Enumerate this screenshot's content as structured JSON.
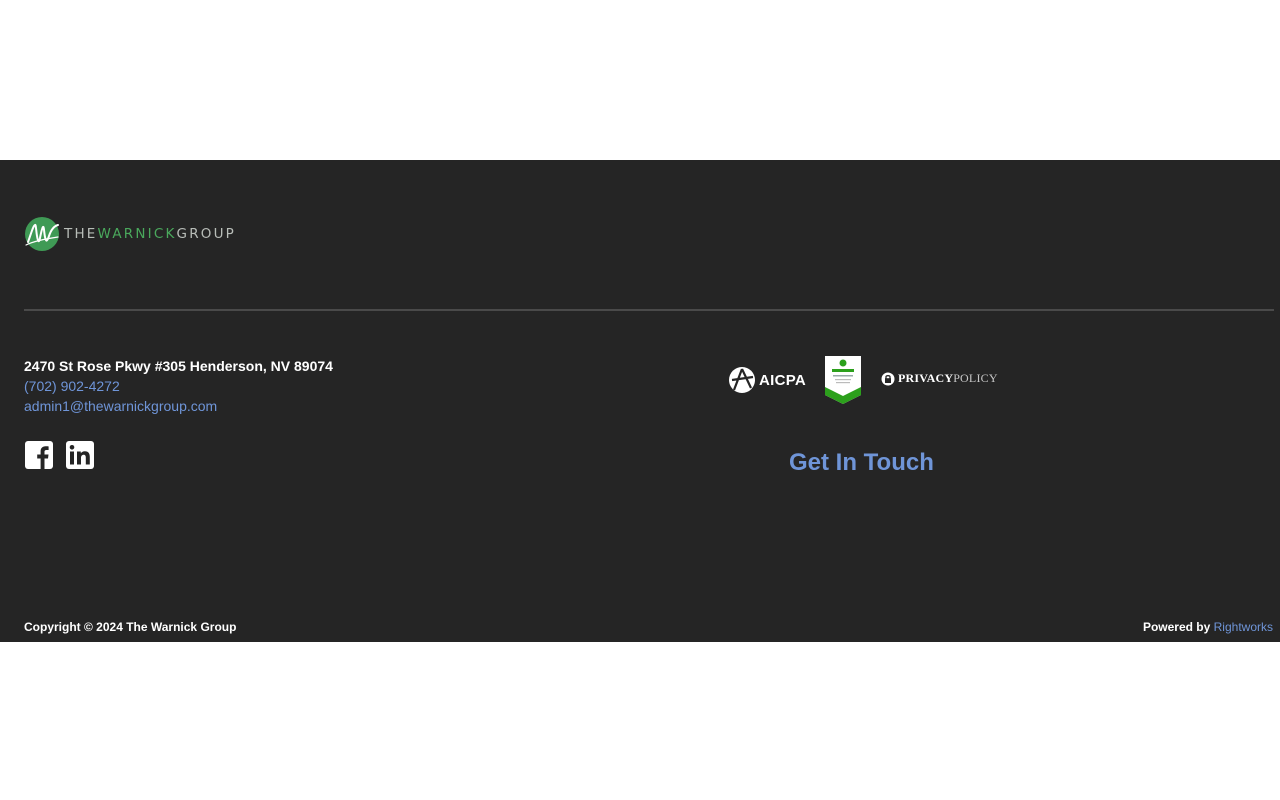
{
  "brand": {
    "logo_text_the": "THE",
    "logo_text_warnick": "WARNICK",
    "logo_text_group": "GROUP",
    "logo_icon": "warnick-w-icon"
  },
  "contact": {
    "address": "2470 St Rose Pkwy #305 Henderson, NV 89074",
    "phone": "(702) 902-4272",
    "email": "admin1@thewarnickgroup.com"
  },
  "social": {
    "facebook_icon": "facebook-icon",
    "linkedin_icon": "linkedin-icon"
  },
  "badges": {
    "aicpa_label": "AICPA",
    "quickbooks_icon": "quickbooks-certified-badge",
    "privacy_word1": "PRIVACY",
    "privacy_word2": "POLICY"
  },
  "cta": {
    "get_in_touch": "Get In Touch"
  },
  "footer": {
    "copyright": "Copyright © 2024 The Warnick Group",
    "powered_prefix": "Powered by ",
    "powered_link": "Rightworks"
  },
  "colors": {
    "background": "#252525",
    "accent_link": "#6f95d8",
    "brand_green": "#4aa85c"
  }
}
